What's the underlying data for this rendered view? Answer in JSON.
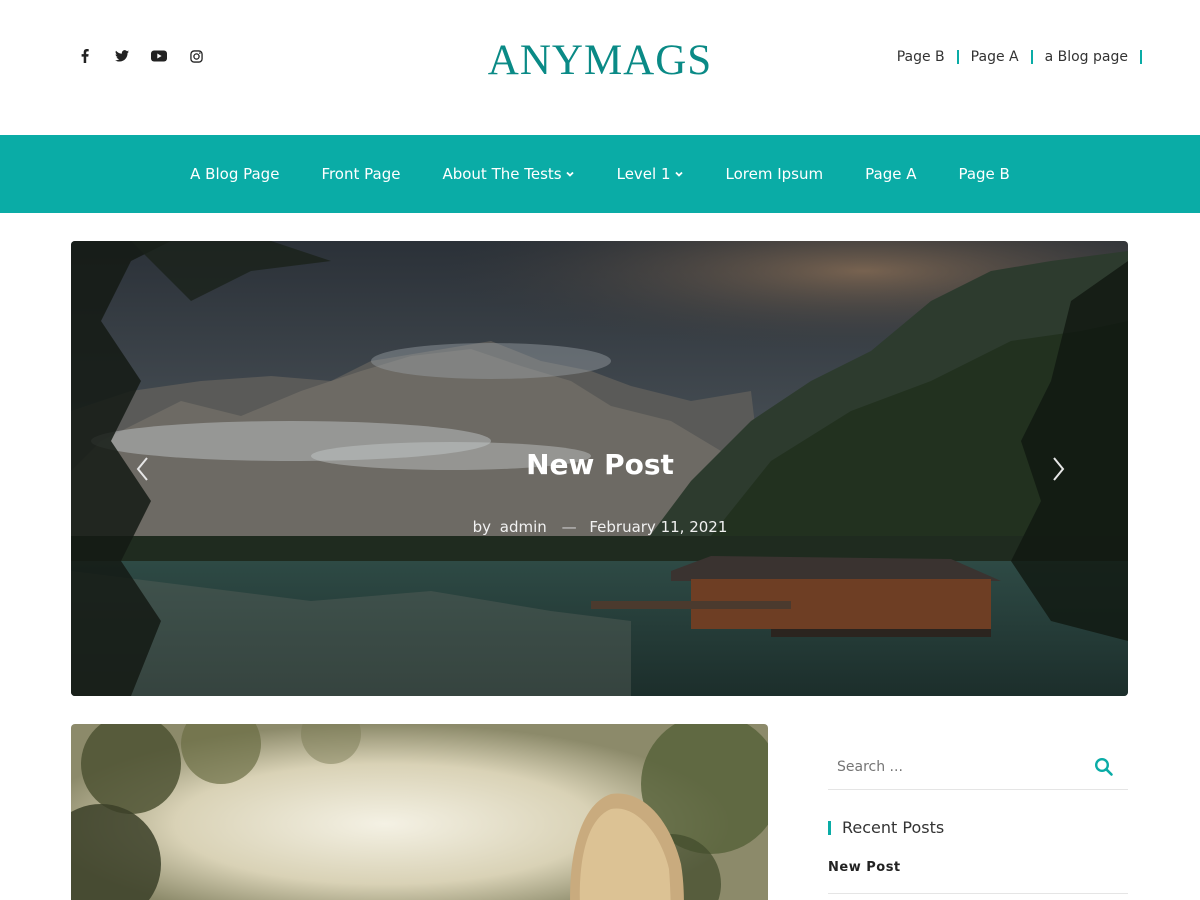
{
  "colors": {
    "accent": "#0aaca6",
    "logo": "#0a8a86",
    "text": "#222222"
  },
  "social": [
    {
      "name": "facebook-icon"
    },
    {
      "name": "twitter-icon"
    },
    {
      "name": "youtube-icon"
    },
    {
      "name": "instagram-icon"
    }
  ],
  "site": {
    "title": "ANYMAGS"
  },
  "top_links": [
    "Page B",
    "Page A",
    "a Blog page"
  ],
  "nav": {
    "items": [
      {
        "label": "A Blog Page",
        "dropdown": false
      },
      {
        "label": "Front Page",
        "dropdown": false
      },
      {
        "label": "About The Tests",
        "dropdown": true
      },
      {
        "label": "Level 1",
        "dropdown": true
      },
      {
        "label": "Lorem Ipsum",
        "dropdown": false
      },
      {
        "label": "Page A",
        "dropdown": false
      },
      {
        "label": "Page B",
        "dropdown": false
      }
    ]
  },
  "slider": {
    "title": "New Post",
    "by": "by",
    "author": "admin",
    "dash": "—",
    "date": "February 11, 2021"
  },
  "sidebar": {
    "search_placeholder": "Search ...",
    "recent_title": "Recent Posts",
    "recent_posts": [
      "New Post"
    ]
  }
}
